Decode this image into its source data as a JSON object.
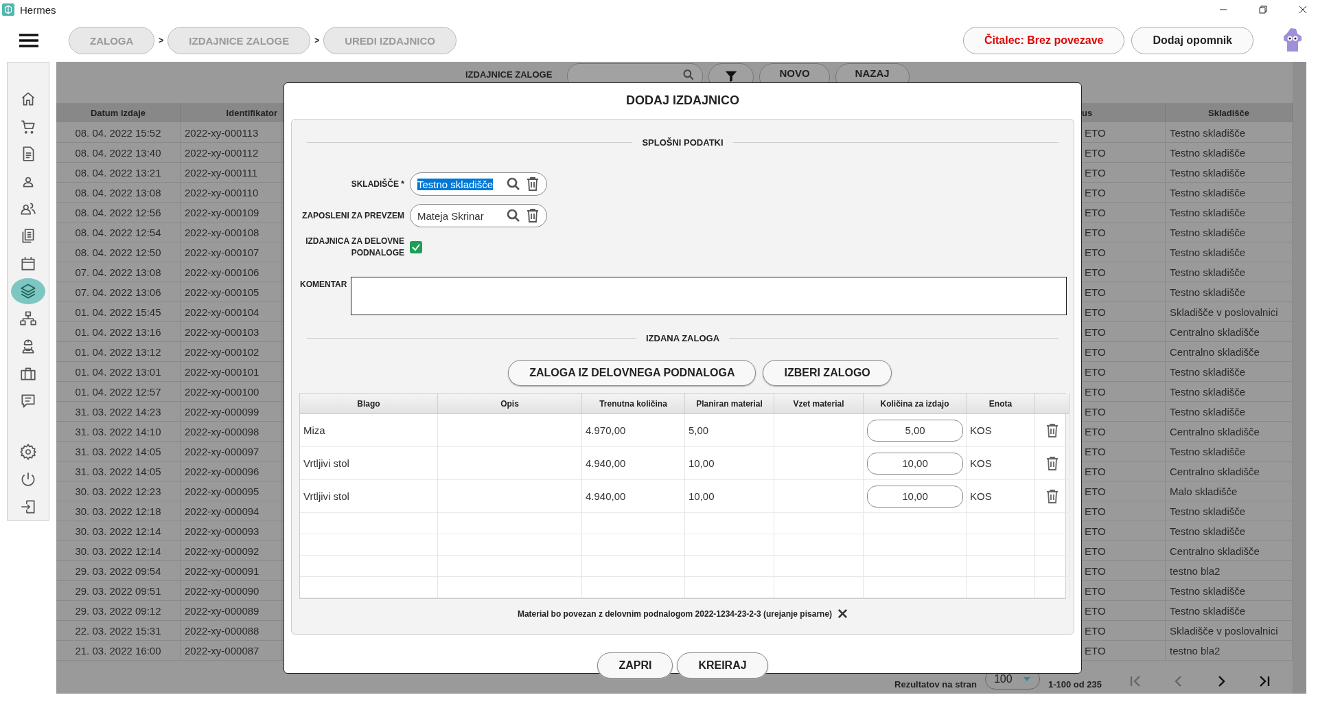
{
  "window": {
    "title": "Hermes"
  },
  "breadcrumbs": [
    {
      "label": "ZALOGA"
    },
    {
      "separator": ">",
      "label": "IZDAJNICE ZALOGE"
    },
    {
      "separator": ">",
      "label": "UREDI IZDAJNICO"
    }
  ],
  "top_buttons": [
    {
      "label": "Čitalec: Brez povezave",
      "kind": "alert"
    },
    {
      "label": "Dodaj opomnik",
      "kind": "normal"
    }
  ],
  "sidebar": {
    "items": [
      {
        "selected": false
      },
      {
        "selected": false
      },
      {
        "selected": false
      },
      {
        "selected": false
      },
      {
        "selected": false
      },
      {
        "selected": false
      },
      {
        "selected": false
      },
      {
        "selected": true
      },
      {
        "selected": false
      },
      {
        "selected": false
      },
      {
        "selected": false
      },
      {
        "selected": false
      }
    ]
  },
  "toolbar": {
    "label": "IZDAJNICE ZALOGE",
    "buttons": [
      "NOVO",
      "NAZAJ"
    ]
  },
  "table": {
    "columns": [
      "Datum izdaje",
      "Identifikator",
      "us",
      "Skladišče"
    ],
    "rows": [
      {
        "date": "08. 04. 2022 15:52",
        "id": "2022-xy-000113",
        "status": "ETO",
        "warehouse": "Testno skladišče"
      },
      {
        "date": "08. 04. 2022 13:40",
        "id": "2022-xy-000112",
        "status": "ETO",
        "warehouse": "Testno skladišče"
      },
      {
        "date": "08. 04. 2022 13:21",
        "id": "2022-xy-000111",
        "status": "ETO",
        "warehouse": "Testno skladišče"
      },
      {
        "date": "08. 04. 2022 13:08",
        "id": "2022-xy-000110",
        "status": "ETO",
        "warehouse": "Testno skladišče"
      },
      {
        "date": "08. 04. 2022 12:56",
        "id": "2022-xy-000109",
        "status": "ETO",
        "warehouse": "Testno skladišče"
      },
      {
        "date": "08. 04. 2022 12:54",
        "id": "2022-xy-000108",
        "status": "ETO",
        "warehouse": "Testno skladišče"
      },
      {
        "date": "08. 04. 2022 12:50",
        "id": "2022-xy-000107",
        "status": "ETO",
        "warehouse": "Testno skladišče"
      },
      {
        "date": "07. 04. 2022 13:08",
        "id": "2022-xy-000106",
        "status": "ETO",
        "warehouse": "Testno skladišče"
      },
      {
        "date": "07. 04. 2022 13:06",
        "id": "2022-xy-000105",
        "status": "ETO",
        "warehouse": "Testno skladišče"
      },
      {
        "date": "01. 04. 2022 15:45",
        "id": "2022-xy-000104",
        "status": "ETO",
        "warehouse": "Skladišče v poslovalnici"
      },
      {
        "date": "01. 04. 2022 13:16",
        "id": "2022-xy-000103",
        "status": "ETO",
        "warehouse": "Centralno skladišče"
      },
      {
        "date": "01. 04. 2022 13:12",
        "id": "2022-xy-000102",
        "status": "ETO",
        "warehouse": "Centralno skladišče"
      },
      {
        "date": "01. 04. 2022 13:01",
        "id": "2022-xy-000101",
        "status": "ETO",
        "warehouse": "Testno skladišče"
      },
      {
        "date": "01. 04. 2022 12:57",
        "id": "2022-xy-000100",
        "status": "ETO",
        "warehouse": "Testno skladišče"
      },
      {
        "date": "31. 03. 2022 14:23",
        "id": "2022-xy-000099",
        "status": "ETO",
        "warehouse": "Testno skladišče"
      },
      {
        "date": "31. 03. 2022 14:10",
        "id": "2022-xy-000098",
        "status": "ETO",
        "warehouse": "Centralno skladišče"
      },
      {
        "date": "31. 03. 2022 14:05",
        "id": "2022-xy-000097",
        "status": "ETO",
        "warehouse": "Testno skladišče"
      },
      {
        "date": "31. 03. 2022 14:05",
        "id": "2022-xy-000096",
        "status": "ETO",
        "warehouse": "Centralno skladišče"
      },
      {
        "date": "30. 03. 2022 12:23",
        "id": "2022-xy-000095",
        "status": "ETO",
        "warehouse": "Malo skladišče"
      },
      {
        "date": "30. 03. 2022 12:18",
        "id": "2022-xy-000094",
        "status": "ETO",
        "warehouse": "Testno skladišče"
      },
      {
        "date": "30. 03. 2022 12:14",
        "id": "2022-xy-000093",
        "status": "ETO",
        "warehouse": "Testno skladišče"
      },
      {
        "date": "30. 03. 2022 12:14",
        "id": "2022-xy-000092",
        "status": "ETO",
        "warehouse": "Centralno skladišče"
      },
      {
        "date": "29. 03. 2022 09:54",
        "id": "2022-xy-000091",
        "status": "ETO",
        "warehouse": "testno bla2"
      },
      {
        "date": "29. 03. 2022 09:51",
        "id": "2022-xy-000090",
        "status": "ETO",
        "warehouse": "Testno skladišče"
      },
      {
        "date": "29. 03. 2022 09:12",
        "id": "2022-xy-000089",
        "status": "ETO",
        "warehouse": "Testno skladišče"
      },
      {
        "date": "22. 03. 2022 15:31",
        "id": "2022-xy-000088",
        "status": "ETO",
        "warehouse": "Skladišče v poslovalnici"
      },
      {
        "date": "21. 03. 2022 16:00",
        "id": "2022-xy-000087",
        "status": "ETO",
        "warehouse": "testno bla2"
      }
    ]
  },
  "pagination": {
    "label": "Rezultatov na stran",
    "page_size": "100",
    "range": "1-100 od 235",
    "nav": [
      {
        "disabled": true
      },
      {
        "disabled": true
      },
      {
        "disabled": false
      },
      {
        "disabled": false
      }
    ]
  },
  "dialog": {
    "title": "DODAJ IZDAJNICO",
    "section_general": "SPLOŠNI PODATKI",
    "warehouse": {
      "label": "SKLADIŠČE *",
      "value": "Testno skladišče",
      "highlighted": true
    },
    "employee": {
      "label": "ZAPOSLENI ZA PREVZEM",
      "value": "Mateja Skrinar",
      "highlighted": false
    },
    "suborder": {
      "label": "IZDAJNICA ZA DELOVNE PODNALOGE",
      "checked": true
    },
    "comment": {
      "label": "KOMENTAR"
    },
    "section_stock": "IZDANA ZALOGA",
    "stock_buttons": [
      "ZALOGA IZ DELOVNEGA PODNALOGA",
      "IZBERI ZALOGO"
    ],
    "items": {
      "columns": [
        "Blago",
        "Opis",
        "Trenutna količina",
        "Planiran material",
        "Vzet material",
        "Količina za izdajo",
        "Enota"
      ],
      "rows": [
        {
          "item": "Miza",
          "current": "4.970,00",
          "planned": "5,00",
          "quantity": "5,00",
          "unit": "KOS"
        },
        {
          "item": "Vrtljivi stol",
          "current": "4.940,00",
          "planned": "10,00",
          "quantity": "10,00",
          "unit": "KOS"
        },
        {
          "item": "Vrtljivi stol",
          "current": "4.940,00",
          "planned": "10,00",
          "quantity": "10,00",
          "unit": "KOS"
        }
      ]
    },
    "note": "Material bo povezan z delovnim podnalogom 2022-1234-23-2-3 (urejanje pisarne)",
    "buttons": [
      "ZAPRI",
      "KREIRAJ"
    ]
  }
}
